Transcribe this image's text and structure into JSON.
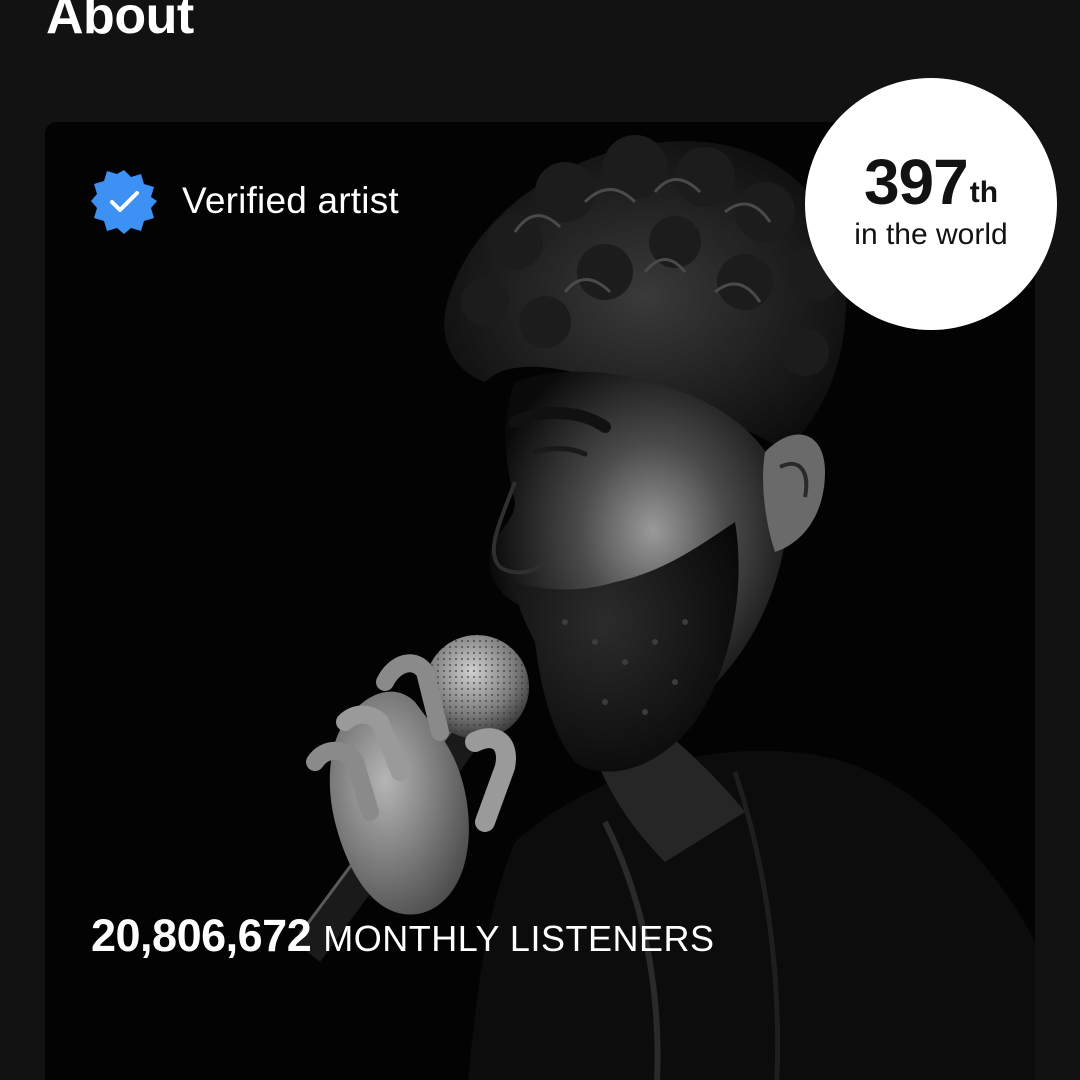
{
  "section": {
    "title": "About"
  },
  "card": {
    "verified_label": "Verified artist",
    "verified_icon": "verified-badge-icon",
    "verified_color": "#3d91f4",
    "photo_description_icon": "artist-photo",
    "listeners": {
      "count": "20,806,672",
      "label": "MONTHLY LISTENERS"
    }
  },
  "rank": {
    "number": "397",
    "suffix": "th",
    "caption": "in the world"
  }
}
